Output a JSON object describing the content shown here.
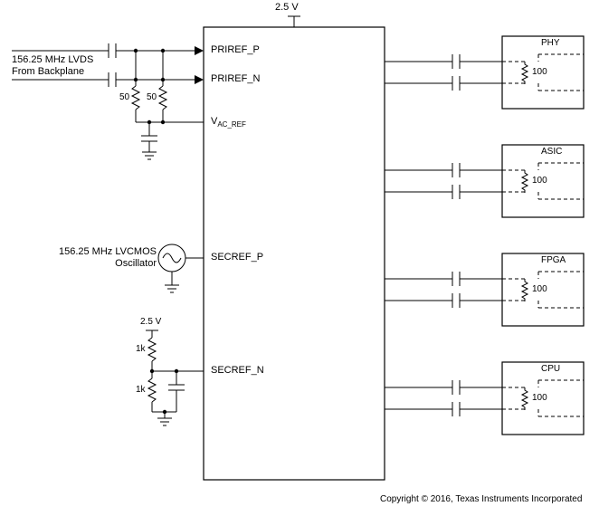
{
  "supply_voltage": "2.5 V",
  "input_lvds": {
    "label_line1": "156.25 MHz LVDS",
    "label_line2": "From Backplane",
    "term_r1": "50",
    "term_r2": "50"
  },
  "oscillator": {
    "label_line1": "156.25 MHz LVCMOS",
    "label_line2": "Oscillator"
  },
  "bias": {
    "voltage": "2.5 V",
    "r1": "1k",
    "r2": "1k"
  },
  "main_chip": {
    "pins": {
      "priref_p": "PRIREF_P",
      "priref_n": "PRIREF_N",
      "vac_ref_prefix": "V",
      "vac_ref_suffix": "AC_REF",
      "secref_p": "SECREF_P",
      "secref_n": "SECREF_N"
    }
  },
  "outputs": [
    {
      "name": "PHY",
      "termination": "100"
    },
    {
      "name": "ASIC",
      "termination": "100"
    },
    {
      "name": "FPGA",
      "termination": "100"
    },
    {
      "name": "CPU",
      "termination": "100"
    }
  ],
  "copyright": "Copyright © 2016, Texas Instruments Incorporated"
}
